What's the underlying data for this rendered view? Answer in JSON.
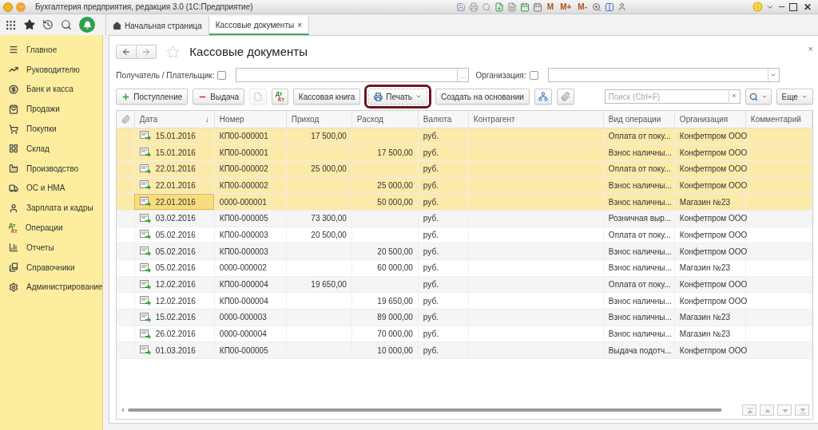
{
  "window": {
    "title": "Бухгалтерия предприятия, редакция 3.0  (1С:Предприятие)",
    "memory_buttons": [
      "M",
      "M+",
      "M-"
    ],
    "close": "✕"
  },
  "tabs": [
    {
      "label": "Начальная страница",
      "selected": false
    },
    {
      "label": "Кассовые документы",
      "selected": true,
      "close": "×"
    }
  ],
  "sidebar": {
    "items": [
      {
        "label": "Главное"
      },
      {
        "label": "Руководителю"
      },
      {
        "label": "Банк и касса"
      },
      {
        "label": "Продажи"
      },
      {
        "label": "Покупки"
      },
      {
        "label": "Склад"
      },
      {
        "label": "Производство"
      },
      {
        "label": "ОС и НМА"
      },
      {
        "label": "Зарплата и кадры"
      },
      {
        "label": "Операции",
        "icon_text": [
          "Дт",
          "Кт"
        ]
      },
      {
        "label": "Отчеты"
      },
      {
        "label": "Справочники"
      },
      {
        "label": "Администрирование"
      }
    ]
  },
  "page": {
    "title": "Кассовые документы",
    "close": "×"
  },
  "filters": [
    {
      "label": "Получатель / Плательщик:",
      "checked": false,
      "kind": "choice",
      "button": "..."
    },
    {
      "label": "Организация:",
      "checked": false,
      "kind": "dropdown"
    }
  ],
  "toolbar": [
    {
      "kind": "add",
      "label": "Поступление",
      "disabled": false,
      "highlighted": false
    },
    {
      "kind": "remove",
      "label": "Выдача",
      "disabled": false,
      "highlighted": false
    },
    {
      "kind": "icon",
      "disabled": true,
      "highlighted": false
    },
    {
      "kind": "dtkt",
      "top": "Дт",
      "bottom": "Кт",
      "disabled": false,
      "highlighted": false
    },
    {
      "kind": "button",
      "label": "Кассовая книга",
      "disabled": false,
      "highlighted": false
    },
    {
      "kind": "print",
      "label": "Печать",
      "disabled": false,
      "highlighted": true
    },
    {
      "kind": "button",
      "label": "Создать на основании",
      "disabled": false,
      "highlighted": false
    },
    {
      "kind": "icon",
      "disabled": false,
      "highlighted": false
    },
    {
      "kind": "icon",
      "disabled": false,
      "highlighted": false
    }
  ],
  "search": {
    "placeholder": "Поиск (Ctrl+F)",
    "clear": "×",
    "more": "Еще"
  },
  "table": {
    "columns": [
      {
        "kind": "attach"
      },
      {
        "label": "Дата",
        "sort": "↓"
      },
      {
        "label": "Номер"
      },
      {
        "label": "Приход"
      },
      {
        "label": "Расход"
      },
      {
        "label": "Валюта"
      },
      {
        "label": "Контрагент"
      },
      {
        "label": "Вид операции"
      },
      {
        "label": "Организация"
      },
      {
        "label": "Комментарий"
      }
    ],
    "rows": [
      {
        "date": "15.01.2016",
        "number": "КП00-000001",
        "income": "17 500,00",
        "expense": "",
        "currency": "руб.",
        "operation": "Оплата от поку...",
        "organization": "Конфетпром ООО",
        "selected": true,
        "current": false
      },
      {
        "date": "15.01.2016",
        "number": "КП00-000001",
        "income": "",
        "expense": "17 500,00",
        "currency": "руб.",
        "operation": "Взнос наличны...",
        "organization": "Конфетпром ООО",
        "selected": true,
        "current": false
      },
      {
        "date": "22.01.2016",
        "number": "КП00-000002",
        "income": "25 000,00",
        "expense": "",
        "currency": "руб.",
        "operation": "Оплата от поку...",
        "organization": "Конфетпром ООО",
        "selected": true,
        "current": false
      },
      {
        "date": "22.01.2016",
        "number": "КП00-000002",
        "income": "",
        "expense": "25 000,00",
        "currency": "руб.",
        "operation": "Взнос наличны...",
        "organization": "Конфетпром ООО",
        "selected": true,
        "current": false
      },
      {
        "date": "22.01.2016",
        "number": "0000-000001",
        "income": "",
        "expense": "50 000,00",
        "currency": "руб.",
        "operation": "Взнос наличны...",
        "organization": "Магазин №23",
        "selected": true,
        "current": true
      },
      {
        "date": "03.02.2016",
        "number": "КП00-000005",
        "income": "73 300,00",
        "expense": "",
        "currency": "руб.",
        "operation": "Розничная выр...",
        "organization": "Конфетпром ООО",
        "selected": false,
        "current": false
      },
      {
        "date": "05.02.2016",
        "number": "КП00-000003",
        "income": "20 500,00",
        "expense": "",
        "currency": "руб.",
        "operation": "Оплата от поку...",
        "organization": "Конфетпром ООО",
        "selected": false,
        "current": false
      },
      {
        "date": "05.02.2016",
        "number": "КП00-000003",
        "income": "",
        "expense": "20 500,00",
        "currency": "руб.",
        "operation": "Взнос наличны...",
        "organization": "Конфетпром ООО",
        "selected": false,
        "current": false
      },
      {
        "date": "05.02.2016",
        "number": "0000-000002",
        "income": "",
        "expense": "60 000,00",
        "currency": "руб.",
        "operation": "Взнос наличны...",
        "organization": "Магазин №23",
        "selected": false,
        "current": false
      },
      {
        "date": "12.02.2016",
        "number": "КП00-000004",
        "income": "19 650,00",
        "expense": "",
        "currency": "руб.",
        "operation": "Оплата от поку...",
        "organization": "Конфетпром ООО",
        "selected": false,
        "current": false
      },
      {
        "date": "12.02.2016",
        "number": "КП00-000004",
        "income": "",
        "expense": "19 650,00",
        "currency": "руб.",
        "operation": "Взнос наличны...",
        "organization": "Конфетпром ООО",
        "selected": false,
        "current": false
      },
      {
        "date": "15.02.2016",
        "number": "0000-000003",
        "income": "",
        "expense": "89 000,00",
        "currency": "руб.",
        "operation": "Взнос наличны...",
        "organization": "Магазин №23",
        "selected": false,
        "current": false
      },
      {
        "date": "26.02.2016",
        "number": "0000-000004",
        "income": "",
        "expense": "70 000,00",
        "currency": "руб.",
        "operation": "Взнос наличны...",
        "organization": "Магазин №23",
        "selected": false,
        "current": false
      },
      {
        "date": "01.03.2016",
        "number": "КП00-000005",
        "income": "",
        "expense": "10 000,00",
        "currency": "руб.",
        "operation": "Выдача подотч...",
        "organization": "Конфетпром ООО",
        "selected": false,
        "current": false
      }
    ]
  }
}
